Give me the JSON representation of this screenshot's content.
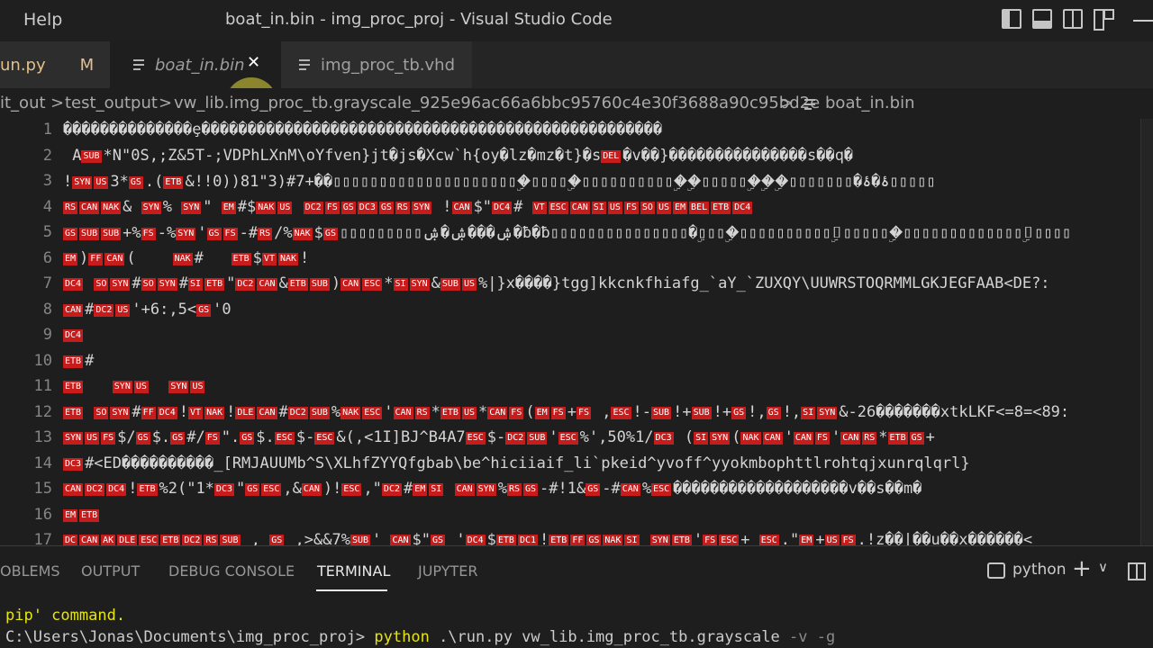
{
  "window": {
    "menu_help": "Help",
    "title": "boat_in.bin - img_proc_proj - Visual Studio Code"
  },
  "tabs": [
    {
      "label": "un.py",
      "status": "M"
    },
    {
      "label": "boat_in.bin",
      "close": "✕"
    },
    {
      "label": "img_proc_tb.vhd"
    }
  ],
  "breadcrumb": {
    "p1": "it_out",
    "p2": "test_output",
    "p3": "vw_lib.img_proc_tb.grayscale_925e96ac66a6bbc95760c4e30f3688a90c95bd2e",
    "p4": "boat_in.bin",
    "sep": ">"
  },
  "editor": {
    "lines": [
      {
        "n": "1",
        "parts": [
          [
            "t",
            "��������������ȩ��������������������������������������������������"
          ]
        ]
      },
      {
        "n": "2",
        "parts": [
          [
            "t",
            " A"
          ],
          [
            "c",
            "SUB"
          ],
          [
            "t",
            "*N\"0S,;Z&5T-;VDPhLXnM\\oYfven}jt�js�Xcw`h{oy�lz�mz�t}�s"
          ],
          [
            "c",
            "DEL"
          ],
          [
            "t",
            "�v��}���������������s��q�"
          ]
        ]
      },
      {
        "n": "3",
        "parts": [
          [
            "t",
            "!"
          ],
          [
            "c",
            "SYN"
          ],
          [
            "c",
            "US"
          ],
          [
            "t",
            "3*"
          ],
          [
            "c",
            "GS"
          ],
          [
            "t",
            ".("
          ],
          [
            "c",
            "ETB"
          ],
          [
            "t",
            "&!!0))81\"3)#7+��▯▯▯▯▯▯▯▯▯▯▯▯▯▯▯▯▯▯▯▯�ۣ▯▯▯▯�ۣ▯▯▯▯▯▯▯▯▯▯�ۣ�ۣ▯▯▯▯▯�ۣ�ۣ�ۣ▯▯▯▯▯▯▯�ۂ�ۂ▯▯▯▯▯"
          ]
        ]
      },
      {
        "n": "4",
        "parts": [
          [
            "c",
            "RS"
          ],
          [
            "c",
            "CAN"
          ],
          [
            "c",
            "NAK"
          ],
          [
            "t",
            "& "
          ],
          [
            "c",
            "SYN"
          ],
          [
            "t",
            "% "
          ],
          [
            "c",
            "SYN"
          ],
          [
            "t",
            "\" "
          ],
          [
            "c",
            "EM"
          ],
          [
            "t",
            "#$"
          ],
          [
            "c",
            "NAK"
          ],
          [
            "c",
            "US"
          ],
          [
            "t",
            " "
          ],
          [
            "c",
            "DC2"
          ],
          [
            "c",
            "FS"
          ],
          [
            "c",
            "GS"
          ],
          [
            "c",
            "DC3"
          ],
          [
            "c",
            "GS"
          ],
          [
            "c",
            "RS"
          ],
          [
            "c",
            "SYN"
          ],
          [
            "t",
            " !"
          ],
          [
            "c",
            "CAN"
          ],
          [
            "t",
            "$\""
          ],
          [
            "c",
            "DC4"
          ],
          [
            "t",
            "# "
          ],
          [
            "c",
            "VT"
          ],
          [
            "c",
            "ESC"
          ],
          [
            "c",
            "CAN"
          ],
          [
            "c",
            "SI"
          ],
          [
            "c",
            "US"
          ],
          [
            "c",
            "FS"
          ],
          [
            "c",
            "SO"
          ],
          [
            "c",
            "US"
          ],
          [
            "c",
            "EM"
          ],
          [
            "c",
            "BEL"
          ],
          [
            "c",
            "ETB"
          ],
          [
            "c",
            "DC4"
          ]
        ]
      },
      {
        "n": "5",
        "parts": [
          [
            "c",
            "GS"
          ],
          [
            "c",
            "SUB"
          ],
          [
            "c",
            "SUB"
          ],
          [
            "t",
            "+%"
          ],
          [
            "c",
            "FS"
          ],
          [
            "t",
            "-%"
          ],
          [
            "c",
            "SYN"
          ],
          [
            "t",
            "'"
          ],
          [
            "c",
            "GS"
          ],
          [
            "c",
            "FS"
          ],
          [
            "t",
            "-#"
          ],
          [
            "c",
            "RS"
          ],
          [
            "t",
            "/%"
          ],
          [
            "c",
            "NAK"
          ],
          [
            "t",
            "$"
          ],
          [
            "c",
            "GS"
          ],
          [
            "t",
            "▯▯▯▯▯▯▯▯▯ۺ���ۺ�ۺ�ƀ�ƀ▯▯▯▯▯▯▯▯▯▯▯▯▯▯▯�ۣ▯▯▯�ۣ▯▯▯▯▯▯▯▯▯▯▯ۣ▯▯▯▯▯�ۣ▯▯▯▯▯▯▯▯▯▯▯▯▯▯ۣ▯▯▯▯"
          ]
        ]
      },
      {
        "n": "6",
        "parts": [
          [
            "c",
            "EM"
          ],
          [
            "t",
            ")"
          ],
          [
            "c",
            "FF"
          ],
          [
            "c",
            "CAN"
          ],
          [
            "t",
            "(    "
          ],
          [
            "c",
            "NAK"
          ],
          [
            "t",
            "#   "
          ],
          [
            "c",
            "ETB"
          ],
          [
            "t",
            "$"
          ],
          [
            "c",
            "VT"
          ],
          [
            "c",
            "NAK"
          ],
          [
            "t",
            "!"
          ]
        ]
      },
      {
        "n": "7",
        "parts": [
          [
            "c",
            "DC4"
          ],
          [
            "t",
            " "
          ],
          [
            "c",
            "SO"
          ],
          [
            "c",
            "SYN"
          ],
          [
            "t",
            "#"
          ],
          [
            "c",
            "SO"
          ],
          [
            "c",
            "SYN"
          ],
          [
            "t",
            "#"
          ],
          [
            "c",
            "SI"
          ],
          [
            "c",
            "ETB"
          ],
          [
            "t",
            "\""
          ],
          [
            "c",
            "DC2"
          ],
          [
            "c",
            "CAN"
          ],
          [
            "t",
            "&"
          ],
          [
            "c",
            "ETB"
          ],
          [
            "c",
            "SUB"
          ],
          [
            "t",
            ")"
          ],
          [
            "c",
            "CAN"
          ],
          [
            "c",
            "ESC"
          ],
          [
            "t",
            "*"
          ],
          [
            "c",
            "SI"
          ],
          [
            "c",
            "SYN"
          ],
          [
            "t",
            "&"
          ],
          [
            "c",
            "SUB"
          ],
          [
            "c",
            "US"
          ],
          [
            "t",
            "%|}x����}tgg]kkcnkfhiafg_`aY_`ZUXQY\\UUWRSTOQRMMLGKJEGFAAB<DE?:"
          ]
        ]
      },
      {
        "n": "8",
        "parts": [
          [
            "c",
            "CAN"
          ],
          [
            "t",
            "#"
          ],
          [
            "c",
            "DC2"
          ],
          [
            "c",
            "US"
          ],
          [
            "t",
            "'+6:,5<"
          ],
          [
            "c",
            "GS"
          ],
          [
            "t",
            "'0"
          ]
        ]
      },
      {
        "n": "9",
        "parts": [
          [
            "c",
            "DC4"
          ]
        ]
      },
      {
        "n": "10",
        "parts": [
          [
            "c",
            "ETB"
          ],
          [
            "t",
            "#"
          ]
        ]
      },
      {
        "n": "11",
        "parts": [
          [
            "c",
            "ETB"
          ],
          [
            "t",
            "   "
          ],
          [
            "c",
            "SYN"
          ],
          [
            "c",
            "US"
          ],
          [
            "t",
            "  "
          ],
          [
            "c",
            "SYN"
          ],
          [
            "c",
            "US"
          ]
        ]
      },
      {
        "n": "12",
        "parts": [
          [
            "c",
            "ETB"
          ],
          [
            "t",
            " "
          ],
          [
            "c",
            "SO"
          ],
          [
            "c",
            "SYN"
          ],
          [
            "t",
            "#"
          ],
          [
            "c",
            "FF"
          ],
          [
            "c",
            "DC4"
          ],
          [
            "t",
            "!"
          ],
          [
            "c",
            "VT"
          ],
          [
            "c",
            "NAK"
          ],
          [
            "t",
            "!"
          ],
          [
            "c",
            "DLE"
          ],
          [
            "c",
            "CAN"
          ],
          [
            "t",
            "#"
          ],
          [
            "c",
            "DC2"
          ],
          [
            "c",
            "SUB"
          ],
          [
            "t",
            "%"
          ],
          [
            "c",
            "NAK"
          ],
          [
            "c",
            "ESC"
          ],
          [
            "t",
            "'"
          ],
          [
            "c",
            "CAN"
          ],
          [
            "c",
            "RS"
          ],
          [
            "t",
            "*"
          ],
          [
            "c",
            "ETB"
          ],
          [
            "c",
            "US"
          ],
          [
            "t",
            "*"
          ],
          [
            "c",
            "CAN"
          ],
          [
            "c",
            "FS"
          ],
          [
            "t",
            "("
          ],
          [
            "c",
            "EM"
          ],
          [
            "c",
            "FS"
          ],
          [
            "t",
            "+"
          ],
          [
            "c",
            "FS"
          ],
          [
            "t",
            " ,"
          ],
          [
            "c",
            "ESC"
          ],
          [
            "t",
            "!-"
          ],
          [
            "c",
            "SUB"
          ],
          [
            "t",
            "!+"
          ],
          [
            "c",
            "SUB"
          ],
          [
            "t",
            "!+"
          ],
          [
            "c",
            "GS"
          ],
          [
            "t",
            "!,"
          ],
          [
            "c",
            "GS"
          ],
          [
            "t",
            "!,"
          ],
          [
            "c",
            "SI"
          ],
          [
            "c",
            "SYN"
          ],
          [
            "t",
            "&-26�������xtkLKF<=8=<89:"
          ]
        ]
      },
      {
        "n": "13",
        "parts": [
          [
            "c",
            "SYN"
          ],
          [
            "c",
            "US"
          ],
          [
            "c",
            "FS"
          ],
          [
            "t",
            "$/"
          ],
          [
            "c",
            "GS"
          ],
          [
            "t",
            "$."
          ],
          [
            "c",
            "GS"
          ],
          [
            "t",
            "#/"
          ],
          [
            "c",
            "FS"
          ],
          [
            "t",
            "\"."
          ],
          [
            "c",
            "GS"
          ],
          [
            "t",
            "$."
          ],
          [
            "c",
            "ESC"
          ],
          [
            "t",
            "$-"
          ],
          [
            "c",
            "ESC"
          ],
          [
            "t",
            "&(,<1I]BJ^B4A7"
          ],
          [
            "c",
            "ESC"
          ],
          [
            "t",
            "$-"
          ],
          [
            "c",
            "DC2"
          ],
          [
            "c",
            "SUB"
          ],
          [
            "t",
            "'"
          ],
          [
            "c",
            "ESC"
          ],
          [
            "t",
            "%',50%1/"
          ],
          [
            "c",
            "DC3"
          ],
          [
            "t",
            " ("
          ],
          [
            "c",
            "SI"
          ],
          [
            "c",
            "SYN"
          ],
          [
            "t",
            "("
          ],
          [
            "c",
            "NAK"
          ],
          [
            "c",
            "CAN"
          ],
          [
            "t",
            "'"
          ],
          [
            "c",
            "CAN"
          ],
          [
            "c",
            "FS"
          ],
          [
            "t",
            "'"
          ],
          [
            "c",
            "CAN"
          ],
          [
            "c",
            "RS"
          ],
          [
            "t",
            "*"
          ],
          [
            "c",
            "ETB"
          ],
          [
            "c",
            "GS"
          ],
          [
            "t",
            "+"
          ]
        ]
      },
      {
        "n": "14",
        "parts": [
          [
            "c",
            "DC3"
          ],
          [
            "t",
            "#<ED����������_[RMJAUUMb^S\\XLhfZYYQfgbab\\be^hiciiaif_li`pkeid^yvoff^yyokmbophttlrohtqjxunrqlqrl}"
          ]
        ]
      },
      {
        "n": "15",
        "parts": [
          [
            "c",
            "CAN"
          ],
          [
            "c",
            "DC2"
          ],
          [
            "c",
            "DC4"
          ],
          [
            "t",
            "!"
          ],
          [
            "c",
            "ETB"
          ],
          [
            "t",
            "%2(\"1*"
          ],
          [
            "c",
            "DC3"
          ],
          [
            "t",
            "\""
          ],
          [
            "c",
            "GS"
          ],
          [
            "c",
            "ESC"
          ],
          [
            "t",
            ",&"
          ],
          [
            "c",
            "CAN"
          ],
          [
            "t",
            ")!"
          ],
          [
            "c",
            "ESC"
          ],
          [
            "t",
            ",\""
          ],
          [
            "c",
            "DC2"
          ],
          [
            "t",
            "#"
          ],
          [
            "c",
            "EM"
          ],
          [
            "c",
            "SI"
          ],
          [
            "t",
            " "
          ],
          [
            "c",
            "CAN"
          ],
          [
            "c",
            "SYN"
          ],
          [
            "t",
            "%"
          ],
          [
            "c",
            "RS"
          ],
          [
            "c",
            "GS"
          ],
          [
            "t",
            "-#!1&"
          ],
          [
            "c",
            "GS"
          ],
          [
            "t",
            "-#"
          ],
          [
            "c",
            "CAN"
          ],
          [
            "t",
            "%"
          ],
          [
            "c",
            "ESC"
          ],
          [
            "t",
            "�������������������v��s��m�"
          ]
        ]
      },
      {
        "n": "16",
        "parts": [
          [
            "c",
            "EM"
          ],
          [
            "c",
            "ETB"
          ]
        ]
      },
      {
        "n": "17",
        "parts": [
          [
            "c",
            "DC"
          ],
          [
            "c",
            "CAN"
          ],
          [
            "c",
            "AK"
          ],
          [
            "c",
            "DLE"
          ],
          [
            "c",
            "ESC"
          ],
          [
            "c",
            "ETB"
          ],
          [
            "c",
            "DC2"
          ],
          [
            "c",
            "RS"
          ],
          [
            "c",
            "SUB"
          ],
          [
            "t",
            " , "
          ],
          [
            "c",
            "GS"
          ],
          [
            "t",
            " ,>&&7%"
          ],
          [
            "c",
            "SUB"
          ],
          [
            "t",
            "' "
          ],
          [
            "c",
            "CAN"
          ],
          [
            "t",
            "$\""
          ],
          [
            "c",
            "GS"
          ],
          [
            "t",
            " '"
          ],
          [
            "c",
            "DC4"
          ],
          [
            "t",
            "$"
          ],
          [
            "c",
            "ETB"
          ],
          [
            "c",
            "DC1"
          ],
          [
            "t",
            "!"
          ],
          [
            "c",
            "ETB"
          ],
          [
            "c",
            "FF"
          ],
          [
            "c",
            "GS"
          ],
          [
            "c",
            "NAK"
          ],
          [
            "c",
            "SI"
          ],
          [
            "t",
            " "
          ],
          [
            "c",
            "SYN"
          ],
          [
            "c",
            "ETB"
          ],
          [
            "t",
            "'"
          ],
          [
            "c",
            "FS"
          ],
          [
            "c",
            "ESC"
          ],
          [
            "t",
            "+ "
          ],
          [
            "c",
            "ESC"
          ],
          [
            "t",
            ".\""
          ],
          [
            "c",
            "EM"
          ],
          [
            "t",
            "+"
          ],
          [
            "c",
            "US"
          ],
          [
            "c",
            "FS"
          ],
          [
            "t",
            ".!z��|��u��x������<"
          ]
        ]
      }
    ]
  },
  "panel": {
    "tabs": [
      {
        "label": "OBLEMS"
      },
      {
        "label": "OUTPUT"
      },
      {
        "label": "DEBUG CONSOLE"
      },
      {
        "label": "TERMINAL"
      },
      {
        "label": "JUPYTER"
      }
    ],
    "terminal_name": "python",
    "plus": "+",
    "chevron": "∨"
  },
  "terminal": {
    "line1": "pip' command.",
    "prompt": "C:\\Users\\Jonas\\Documents\\img_proc_proj> ",
    "cmd": "python",
    "args": " .\\run.py vw_lib.img_proc_tb.grayscale ",
    "flags": "-v -g"
  },
  "colors": {
    "control_badge": "#c71c1c",
    "modified": "#e2c08d",
    "terminal_yellow": "#e5e510"
  }
}
